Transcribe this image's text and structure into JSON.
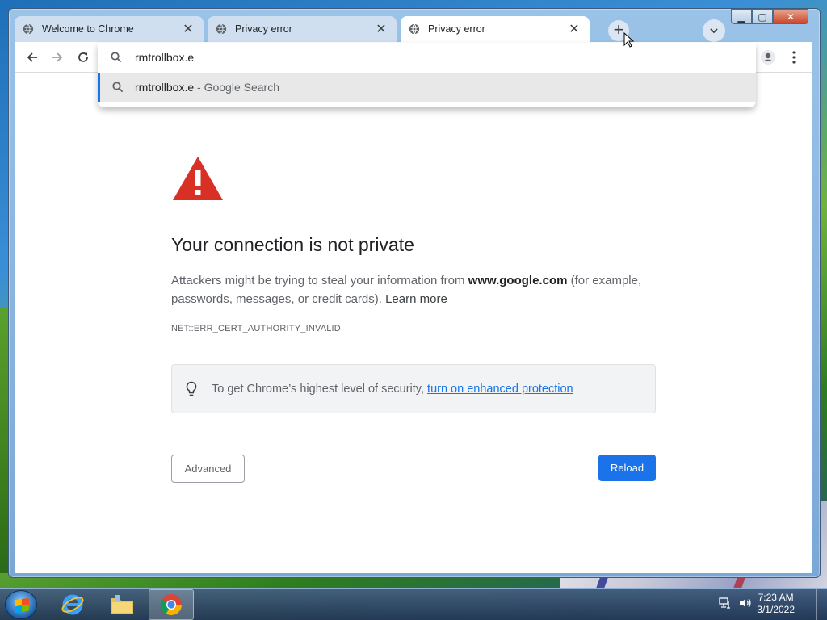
{
  "window": {
    "controls": {
      "minimize": "▁",
      "maximize": "▢",
      "close": "✕"
    }
  },
  "tabs": [
    {
      "label": "Welcome to Chrome",
      "icon": "globe-icon",
      "active": false
    },
    {
      "label": "Privacy error",
      "icon": "globe-icon",
      "active": false
    },
    {
      "label": "Privacy error",
      "icon": "globe-icon",
      "active": true
    }
  ],
  "tab_close_glyph": "✕",
  "new_tab_glyph": "+",
  "omnibox": {
    "value": "rmtrollbox.e",
    "suggestion": {
      "text": "rmtrollbox.e",
      "suffix": " - Google Search"
    }
  },
  "page": {
    "heading": "Your connection is not private",
    "para_prefix": "Attackers might be trying to steal your information from ",
    "domain": "www.google.com",
    "para_suffix": " (for example, passwords, messages, or credit cards). ",
    "learn_more": "Learn more",
    "error_code": "NET::ERR_CERT_AUTHORITY_INVALID",
    "protection_text": "To get Chrome’s highest level of security, ",
    "protection_link": "turn on enhanced protection",
    "advanced_label": "Advanced",
    "reload_label": "Reload"
  },
  "taskbar": {
    "time": "7:23 AM",
    "date": "3/1/2022"
  },
  "colors": {
    "accent": "#1a73e8",
    "warning": "#d93025"
  }
}
